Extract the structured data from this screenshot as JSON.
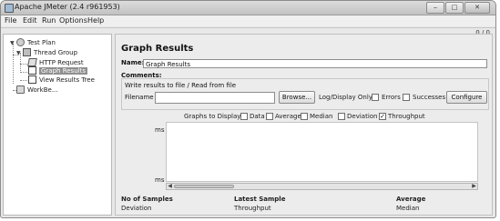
{
  "window": {
    "title": "Apache JMeter (2.4 r961953)",
    "counter": "0 / 0"
  },
  "menu": [
    "File",
    "Edit",
    "Run",
    "Options",
    "Help"
  ],
  "tree": {
    "test_plan": "Test Plan",
    "thread_group": "Thread Group",
    "http_request": "HTTP Request",
    "graph_results": "Graph Results",
    "view_results_tree": "View Results Tree",
    "workbench": "WorkBe..."
  },
  "panel": {
    "title": "Graph Results",
    "name_label": "Name:",
    "name_value": "Graph Results",
    "comments_label": "Comments:",
    "file_section_title": "Write results to file / Read from file",
    "filename_label": "Filename",
    "browse_label": "Browse...",
    "log_display_label": "Log/Display Only:",
    "errors_label": "Errors",
    "successes_label": "Successes",
    "configure_label": "Configure",
    "graphs_to_display_label": "Graphs to Display",
    "graphs": [
      {
        "label": "Data",
        "checked": false
      },
      {
        "label": "Average",
        "checked": false
      },
      {
        "label": "Median",
        "checked": false
      },
      {
        "label": "Deviation",
        "checked": false
      },
      {
        "label": "Throughput",
        "checked": true
      }
    ],
    "axis_top": "ms",
    "axis_bottom": "ms"
  },
  "stats": {
    "no_of_samples": "No of Samples",
    "latest_sample": "Latest Sample",
    "average": "Average",
    "deviation": "Deviation",
    "throughput": "Throughput",
    "median": "Median"
  }
}
